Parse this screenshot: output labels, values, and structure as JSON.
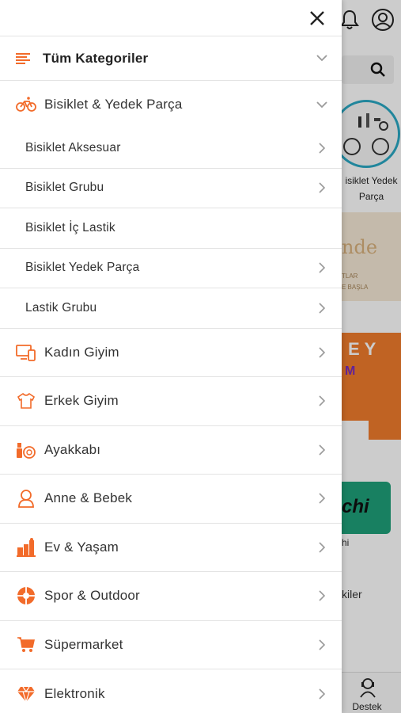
{
  "background": {
    "category_label": "isiklet Yedek Parça",
    "banner1_title": "nde",
    "banner1_sub1": "TLAR",
    "banner1_sub2": "E BAŞLA",
    "banner2_title": "EY",
    "banner2_mark": "M",
    "brand_title": "chi",
    "brand_sub": "hi",
    "section_text": "kiler",
    "bottom_nav_destek": "Destek"
  },
  "drawer": {
    "all_categories": "Tüm Kategoriler",
    "bicycle": {
      "label": "Bisiklet & Yedek Parça",
      "sub_items": [
        {
          "label": "Bisiklet Aksesuar",
          "has_arrow": true
        },
        {
          "label": "Bisiklet Grubu",
          "has_arrow": true
        },
        {
          "label": "Bisiklet İç Lastik",
          "has_arrow": false
        },
        {
          "label": "Bisiklet Yedek Parça",
          "has_arrow": true
        },
        {
          "label": "Lastik Grubu",
          "has_arrow": true
        }
      ]
    },
    "categories": [
      {
        "label": "Kadın Giyim",
        "icon": "devices-icon"
      },
      {
        "label": "Erkek Giyim",
        "icon": "tshirt-icon"
      },
      {
        "label": "Ayakkabı",
        "icon": "cosmetics-icon"
      },
      {
        "label": "Anne & Bebek",
        "icon": "person-icon"
      },
      {
        "label": "Ev & Yaşam",
        "icon": "home-icon"
      },
      {
        "label": "Spor & Outdoor",
        "icon": "ball-icon"
      },
      {
        "label": "Süpermarket",
        "icon": "cart-icon"
      },
      {
        "label": "Elektronik",
        "icon": "diamond-icon"
      }
    ]
  },
  "colors": {
    "accent": "#F26B2A",
    "chevron": "#9a9a9a"
  }
}
